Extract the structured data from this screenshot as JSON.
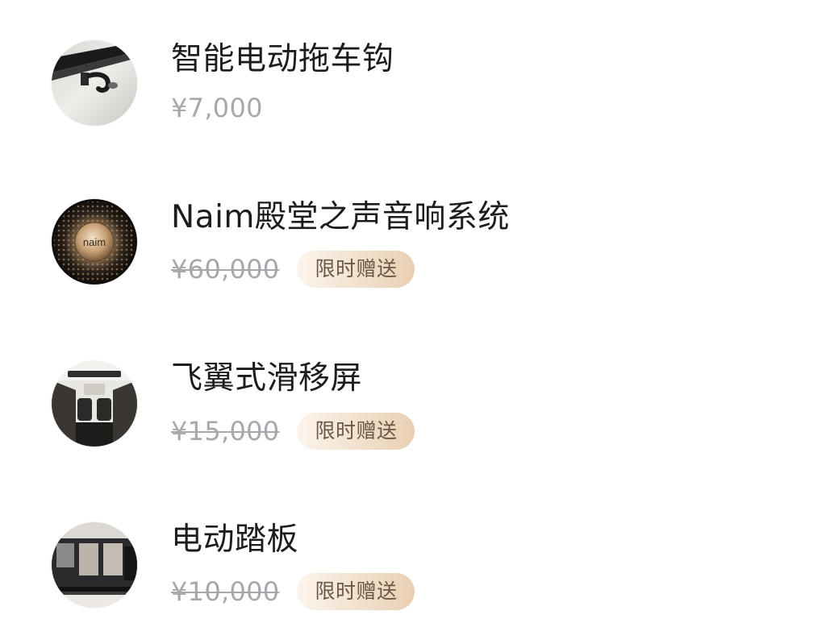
{
  "items": [
    {
      "title": "智能电动拖车钩",
      "price": "¥7,000",
      "badge": "",
      "icon": "tow-hitch-photo"
    },
    {
      "title": "Naim殿堂之声音响系统",
      "price": "¥60,000",
      "badge": "限时赠送",
      "icon": "naim-speaker-photo",
      "logo_text": "naim"
    },
    {
      "title": "飞翼式滑移屏",
      "price": "¥15,000",
      "badge": "限时赠送",
      "icon": "sliding-screen-photo"
    },
    {
      "title": "电动踏板",
      "price": "¥10,000",
      "badge": "限时赠送",
      "icon": "power-step-photo"
    }
  ],
  "colors": {
    "title": "#1c1c1e",
    "price": "#a8a8ac",
    "badge_text": "#6d5848",
    "badge_bg": "#f1e0cc"
  }
}
